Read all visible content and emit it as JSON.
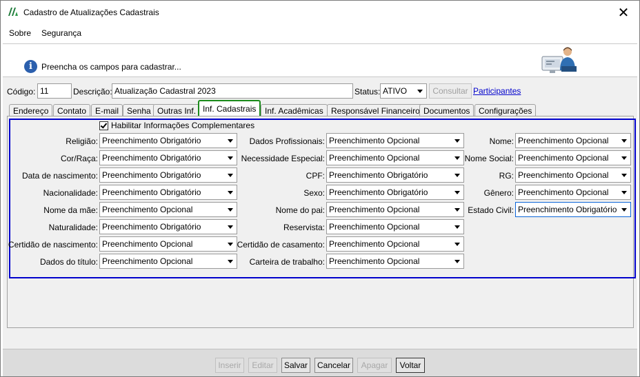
{
  "window": {
    "title": "Cadastro de Atualizações Cadastrais",
    "close_glyph": "✕"
  },
  "menu": [
    "Sobre",
    "Segurança"
  ],
  "banner": {
    "message": "Preencha os campos para cadastrar...",
    "info_glyph": "i"
  },
  "header": {
    "codigo_label": "Código:",
    "codigo_value": "11",
    "descricao_label": "Descrição:",
    "descricao_value": "Atualização Cadastral 2023",
    "status_label": "Status:",
    "status_value": "ATIVO",
    "consultar_label": "Consultar",
    "participantes_label": "Participantes"
  },
  "tabs": [
    "Endereço",
    "Contato",
    "E-mail",
    "Senha",
    "Outras Inf.",
    "Inf. Cadastrais",
    "Inf. Acadêmicas",
    "Responsável Financeiro",
    "Documentos",
    "Configurações"
  ],
  "active_tab": "Inf. Cadastrais",
  "form": {
    "enable_label": "Habilitar Informações Complementares",
    "enable_checked": true,
    "col1": [
      {
        "label": "Religião:",
        "value": "Preenchimento Obrigatório"
      },
      {
        "label": "Cor/Raça:",
        "value": "Preenchimento Obrigatório"
      },
      {
        "label": "Data de nascimento:",
        "value": "Preenchimento Obrigatório"
      },
      {
        "label": "Nacionalidade:",
        "value": "Preenchimento Obrigatório"
      },
      {
        "label": "Nome da mãe:",
        "value": "Preenchimento Opcional"
      },
      {
        "label": "Naturalidade:",
        "value": "Preenchimento Obrigatório"
      },
      {
        "label": "Certidão de nascimento:",
        "value": "Preenchimento Opcional"
      },
      {
        "label": "Dados do título:",
        "value": "Preenchimento Opcional"
      }
    ],
    "col2": [
      {
        "label": "Dados Profissionais:",
        "value": "Preenchimento Opcional"
      },
      {
        "label": "Necessidade Especial:",
        "value": "Preenchimento Opcional"
      },
      {
        "label": "CPF:",
        "value": "Preenchimento Obrigatório"
      },
      {
        "label": "Sexo:",
        "value": "Preenchimento Obrigatório"
      },
      {
        "label": "Nome do pai:",
        "value": "Preenchimento Opcional"
      },
      {
        "label": "Reservista:",
        "value": "Preenchimento Opcional"
      },
      {
        "label": "Certidão de casamento:",
        "value": "Preenchimento Opcional"
      },
      {
        "label": "Carteira de trabalho:",
        "value": "Preenchimento Opcional"
      }
    ],
    "col3": [
      {
        "label": "Nome:",
        "value": "Preenchimento Opcional"
      },
      {
        "label": "Nome Social:",
        "value": "Preenchimento Opcional"
      },
      {
        "label": "RG:",
        "value": "Preenchimento Opcional"
      },
      {
        "label": "Gênero:",
        "value": "Preenchimento Opcional"
      },
      {
        "label": "Estado Civil:",
        "value": "Preenchimento Obrigatório"
      }
    ]
  },
  "footer": {
    "inserir": "Inserir",
    "editar": "Editar",
    "salvar": "Salvar",
    "cancelar": "Cancelar",
    "apagar": "Apagar",
    "voltar": "Voltar"
  },
  "colors": {
    "active_tab_border": "#1a8a1a",
    "group_frame": "#0000cc",
    "link": "#0000cc"
  }
}
